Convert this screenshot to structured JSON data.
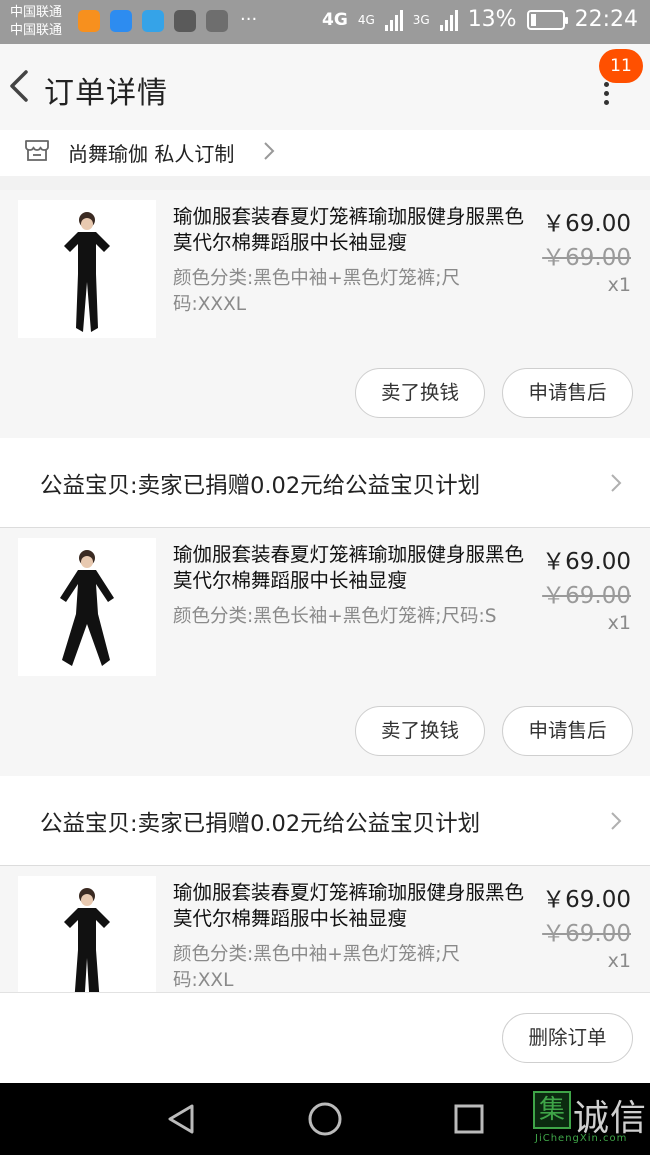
{
  "statusbar": {
    "carrier_1": "中国联通",
    "carrier_2": "中国联通",
    "more": "···",
    "net_a": "4G",
    "net_b": "4G",
    "net_c": "3G",
    "battery": "13%",
    "time": "22:24"
  },
  "header": {
    "title": "订单详情",
    "badge": "11"
  },
  "shop": {
    "name": "尚舞瑜伽 私人订制"
  },
  "items": [
    {
      "title": "瑜伽服套装春夏灯笼裤瑜珈服健身服黑色莫代尔棉舞蹈服中长袖显瘦",
      "spec": "颜色分类:黑色中袖+黑色灯笼裤;尺码:XXXL",
      "price": "￥69.00",
      "original_price": "￥69.00",
      "qty": "x1",
      "btn_sell": "卖了换钱",
      "btn_after": "申请售后"
    },
    {
      "title": "瑜伽服套装春夏灯笼裤瑜珈服健身服黑色莫代尔棉舞蹈服中长袖显瘦",
      "spec": "颜色分类:黑色长袖+黑色灯笼裤;尺码:S",
      "price": "￥69.00",
      "original_price": "￥69.00",
      "qty": "x1",
      "btn_sell": "卖了换钱",
      "btn_after": "申请售后"
    },
    {
      "title": "瑜伽服套装春夏灯笼裤瑜珈服健身服黑色莫代尔棉舞蹈服中长袖显瘦",
      "spec": "颜色分类:黑色中袖+黑色灯笼裤;尺码:XXL",
      "price": "￥69.00",
      "original_price": "￥69.00",
      "qty": "x1"
    }
  ],
  "charity": [
    {
      "text": "公益宝贝:卖家已捐赠0.02元给公益宝贝计划"
    },
    {
      "text": "公益宝贝:卖家已捐赠0.02元给公益宝贝计划"
    }
  ],
  "actions": {
    "delete": "删除订单"
  },
  "watermark": {
    "glyph": "集",
    "text": "诚信",
    "sub": "JiChengXin.com"
  },
  "colors": {
    "accent": "#ff5000",
    "statusbar": "#9b9b9b",
    "watermark_green": "#3fa548"
  }
}
